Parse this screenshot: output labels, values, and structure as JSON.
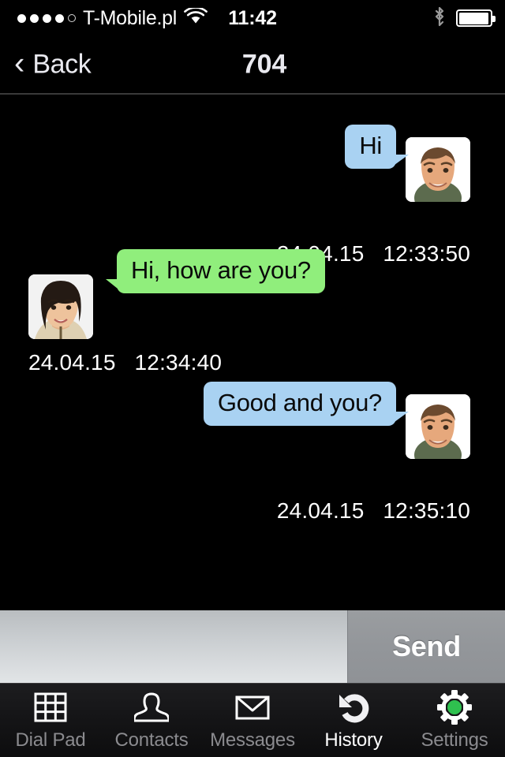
{
  "statusbar": {
    "signal_dots_total": 5,
    "signal_dots_filled": 4,
    "carrier": "T-Mobile.pl",
    "wifi_icon": "wifi-icon",
    "time": "11:42",
    "bluetooth_icon": "bluetooth-icon",
    "battery_icon": "battery-full-icon",
    "battery_level_pct": 90
  },
  "navbar": {
    "back_icon": "chevron-left-icon",
    "back_label": "Back",
    "title": "704"
  },
  "thread": {
    "messages": [
      {
        "id": "m1",
        "direction": "outgoing",
        "text": "Hi",
        "bubble_color": "#a9d2f2",
        "avatar": "avatar-male",
        "date": "24.04.15",
        "time": "12:33:50",
        "timestamp": "24.04.15   12:33:50"
      },
      {
        "id": "m2",
        "direction": "incoming",
        "text": "Hi, how are you?",
        "bubble_color": "#90ee7c",
        "avatar": "avatar-female",
        "date": "24.04.15",
        "time": "12:34:40",
        "timestamp": "24.04.15   12:34:40"
      },
      {
        "id": "m3",
        "direction": "outgoing",
        "text": "Good and you?",
        "bubble_color": "#a9d2f2",
        "avatar": "avatar-male",
        "date": "24.04.15",
        "time": "12:35:10",
        "timestamp": "24.04.15   12:35:10"
      }
    ]
  },
  "compose": {
    "input_value": "",
    "input_placeholder": "",
    "send_label": "Send"
  },
  "tabbar": {
    "active": "History",
    "items": [
      {
        "label": "Dial Pad",
        "icon": "dialpad-grid-icon",
        "active": false
      },
      {
        "label": "Contacts",
        "icon": "person-icon",
        "active": false
      },
      {
        "label": "Messages",
        "icon": "envelope-icon",
        "active": false
      },
      {
        "label": "History",
        "icon": "undo-arrow-icon",
        "active": true
      },
      {
        "label": "Settings",
        "icon": "gear-icon",
        "active": false
      }
    ]
  },
  "colors": {
    "background": "#000000",
    "bubble_outgoing": "#a9d2f2",
    "bubble_incoming": "#90ee7c",
    "tab_active_text": "#ffffff",
    "tab_inactive_text": "#8b8b8f",
    "gear_accent": "#2fc14f"
  }
}
